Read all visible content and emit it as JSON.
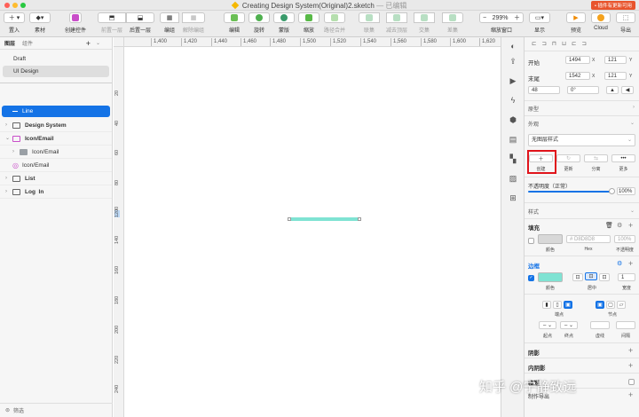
{
  "window": {
    "title": "Creating Design System(Original)2.sketch",
    "status": "— 已编辑",
    "update_badge": "• 插件有更新可用"
  },
  "toolbar": {
    "insert": "置入",
    "assets": "素材",
    "create_symbol": "创建控件",
    "forward": "前置一层",
    "backward": "后置一层",
    "group": "编组",
    "ungroup": "解除编组",
    "edit": "编辑",
    "rotate": "旋转",
    "mask": "蒙版",
    "scale": "缩放",
    "flatten": "路径合并",
    "union": "联集",
    "subtract": "减去顶层",
    "intersect": "交集",
    "difference": "差集",
    "zoom_label": "缩放窗口",
    "zoom_value": "299%",
    "display": "显示",
    "preview": "预览",
    "cloud": "Cloud",
    "export": "导出"
  },
  "left": {
    "tabs": [
      "图层",
      "组件"
    ],
    "pages": [
      "Draft",
      "UI Design"
    ],
    "layers": [
      {
        "name": "Line",
        "selected": true,
        "bold": false
      },
      {
        "name": "Design System",
        "bold": true
      },
      {
        "name": "Icon/Email",
        "bold": true
      },
      {
        "name": "Icon/Email",
        "bold": false
      },
      {
        "name": "Icon/Email",
        "bold": false
      },
      {
        "name": "List",
        "bold": true
      },
      {
        "name": "Log  In",
        "bold": true
      }
    ],
    "filter": "筛选"
  },
  "ruler": {
    "h": [
      "1,400",
      "1,420",
      "1,440",
      "1,460",
      "1,480",
      "1,500",
      "1,520",
      "1,540",
      "1,560",
      "1,580",
      "1,600",
      "1,620"
    ],
    "v": [
      "20",
      "40",
      "60",
      "80",
      "100",
      "120",
      "140",
      "160",
      "180",
      "200",
      "220",
      "240"
    ]
  },
  "inspector": {
    "start": "开始",
    "end": "末尾",
    "start_x": "1494",
    "start_y": "121",
    "end_x": "1542",
    "end_y": "121",
    "width": "48",
    "rotation": "0°",
    "x": "X",
    "y": "Y",
    "prototype": "原型",
    "appearance": "外观",
    "style_select": "无图层样式",
    "actions": [
      "创建",
      "更新",
      "分离",
      "更多"
    ],
    "opacity_label": "不透明度（正常）",
    "opacity_value": "100%",
    "style": "样式",
    "fill": "填充",
    "fill_hex": "# D8D8D8",
    "fill_opacity": "100%",
    "fill_subs": [
      "颜色",
      "Hex",
      "不透明度"
    ],
    "border": "边框",
    "border_width": "1",
    "border_subs": [
      "颜色",
      "居中",
      "宽度"
    ],
    "ends": "端点",
    "joins": "节点",
    "start_arrow": "起点",
    "end_arrow": "终点",
    "dash": "虚线",
    "gap": "间隔",
    "shadow": "阴影",
    "inner_shadow": "内阴影",
    "blur": "模糊",
    "export": "制作导出"
  },
  "colors": {
    "border_color": "#7fe3d3",
    "accent": "#1473e6",
    "highlight": "#e0141b"
  },
  "watermark": "知乎 @宁静致远"
}
